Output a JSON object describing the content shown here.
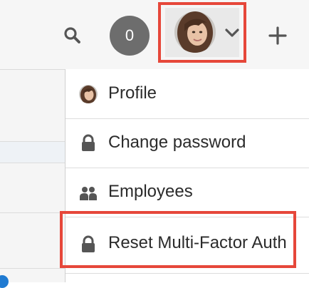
{
  "header": {
    "notification_count": "0",
    "icons": {
      "search": "search-icon",
      "user_menu_chevron": "chevron-down-icon",
      "add": "plus-icon"
    }
  },
  "user_menu": {
    "items": [
      {
        "label": "Profile",
        "icon": "avatar"
      },
      {
        "label": "Change password",
        "icon": "lock-icon"
      },
      {
        "label": "Employees",
        "icon": "people-icon"
      },
      {
        "label": "Reset Multi-Factor Auth",
        "icon": "lock-icon"
      }
    ]
  },
  "colors": {
    "highlight": "#e6473a",
    "badge": "#6d6d6d",
    "icon": "#555555",
    "text": "#2b2b2b"
  }
}
